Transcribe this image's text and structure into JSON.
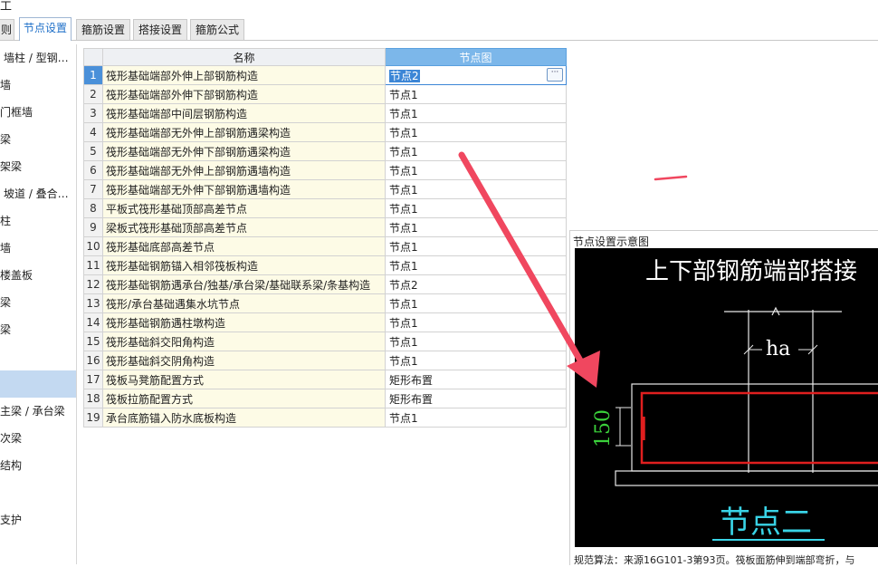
{
  "top_glyph": "工",
  "tabs": [
    "则",
    "节点设置",
    "箍筋设置",
    "搭接设置",
    "箍筋公式"
  ],
  "sidebar": {
    "items": [
      "墙柱 / 型钢…",
      "墙",
      "门框墙",
      "梁",
      "架梁",
      "坡道 / 叠合…",
      "柱",
      "墙",
      "楼盖板",
      "梁",
      "梁",
      "",
      "",
      "主梁 / 承台梁",
      "次梁",
      "结构",
      "",
      "支护"
    ]
  },
  "table": {
    "headers": {
      "name": "名称",
      "node": "节点图"
    },
    "rows": [
      {
        "no": "1",
        "name": "筏形基础端部外伸上部钢筋构造",
        "value": "节点2"
      },
      {
        "no": "2",
        "name": "筏形基础端部外伸下部钢筋构造",
        "value": "节点1"
      },
      {
        "no": "3",
        "name": "筏形基础端部中间层钢筋构造",
        "value": "节点1"
      },
      {
        "no": "4",
        "name": "筏形基础端部无外伸上部钢筋遇梁构造",
        "value": "节点1"
      },
      {
        "no": "5",
        "name": "筏形基础端部无外伸下部钢筋遇梁构造",
        "value": "节点1"
      },
      {
        "no": "6",
        "name": "筏形基础端部无外伸上部钢筋遇墙构造",
        "value": "节点1"
      },
      {
        "no": "7",
        "name": "筏形基础端部无外伸下部钢筋遇墙构造",
        "value": "节点1"
      },
      {
        "no": "8",
        "name": "平板式筏形基础顶部高差节点",
        "value": "节点1"
      },
      {
        "no": "9",
        "name": "梁板式筏形基础顶部高差节点",
        "value": "节点1"
      },
      {
        "no": "10",
        "name": "筏形基础底部高差节点",
        "value": "节点1"
      },
      {
        "no": "11",
        "name": "筏形基础钢筋锚入相邻筏板构造",
        "value": "节点1"
      },
      {
        "no": "12",
        "name": "筏形基础钢筋遇承台/独基/承台梁/基础联系梁/条基构造",
        "value": "节点2"
      },
      {
        "no": "13",
        "name": "筏形/承台基础遇集水坑节点",
        "value": "节点1"
      },
      {
        "no": "14",
        "name": "筏形基础钢筋遇柱墩构造",
        "value": "节点1"
      },
      {
        "no": "15",
        "name": "筏形基础斜交阳角构造",
        "value": "节点1"
      },
      {
        "no": "16",
        "name": "筏形基础斜交阴角构造",
        "value": "节点1"
      },
      {
        "no": "17",
        "name": "筏板马凳筋配置方式",
        "value": "矩形布置"
      },
      {
        "no": "18",
        "name": "筏板拉筋配置方式",
        "value": "矩形布置"
      },
      {
        "no": "19",
        "name": "承台底筋锚入防水底板构造",
        "value": "节点1"
      }
    ],
    "ellipsis": "···"
  },
  "preview": {
    "title": "节点设置示意图",
    "diagram_heading": "上下部钢筋端部搭接",
    "dim_ha": "ha",
    "dim_150": "150",
    "node_label": "节点二",
    "footer": "规范算法：来源16G101-3第93页。筏板面筋伸到端部弯折，与"
  },
  "colors": {
    "accent": "#1e6fc8",
    "header_blue": "#7cb7ea",
    "selected_row": "#4a90d9",
    "arrow": "#f0475f",
    "diagram_rebar": "#e01f1f",
    "diagram_green": "#3bd13b",
    "diagram_cyan": "#39d3e6"
  }
}
